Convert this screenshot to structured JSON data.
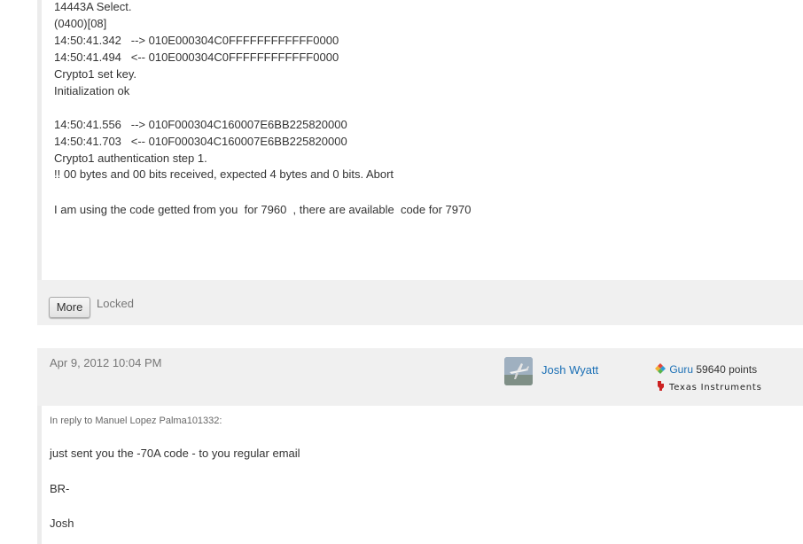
{
  "post1": {
    "lines": [
      "14443A Select.",
      "(0400)[08]",
      "14:50:41.342   --> 010E000304C0FFFFFFFFFFFF0000",
      "14:50:41.494   <-- 010E000304C0FFFFFFFFFFFF0000",
      "Crypto1 set key.",
      "Initialization ok",
      "",
      "14:50:41.556   --> 010F000304C160007E6BB225820000",
      "14:50:41.703   <-- 010F000304C160007E6BB225820000",
      "Crypto1 authentication step 1.",
      "!! 00 bytes and 00 bits received, expected 4 bytes and 0 bits. Abort",
      "",
      "I am using the code getted from you  for 7960  , there are available  code for 7970"
    ],
    "more_label": "More",
    "locked_label": "Locked"
  },
  "post2": {
    "date": "Apr 9, 2012 10:04 PM",
    "author": "Josh Wyatt",
    "rank": "Guru",
    "points": "59640 points",
    "organization": "Texas Instruments",
    "reply_to": "In reply to Manuel Lopez Palma101332:",
    "body": [
      "just sent you the -70A code - to you regular email",
      "BR-",
      "Josh"
    ]
  },
  "icons": {
    "avatar": "user-avatar-image",
    "rank": "guru-rank-icon",
    "organization": "texas-instruments-logo-icon"
  },
  "colors": {
    "link": "#1a6fb5",
    "panel_bg": "#f0f0f0",
    "text": "#333333",
    "muted": "#777777"
  }
}
